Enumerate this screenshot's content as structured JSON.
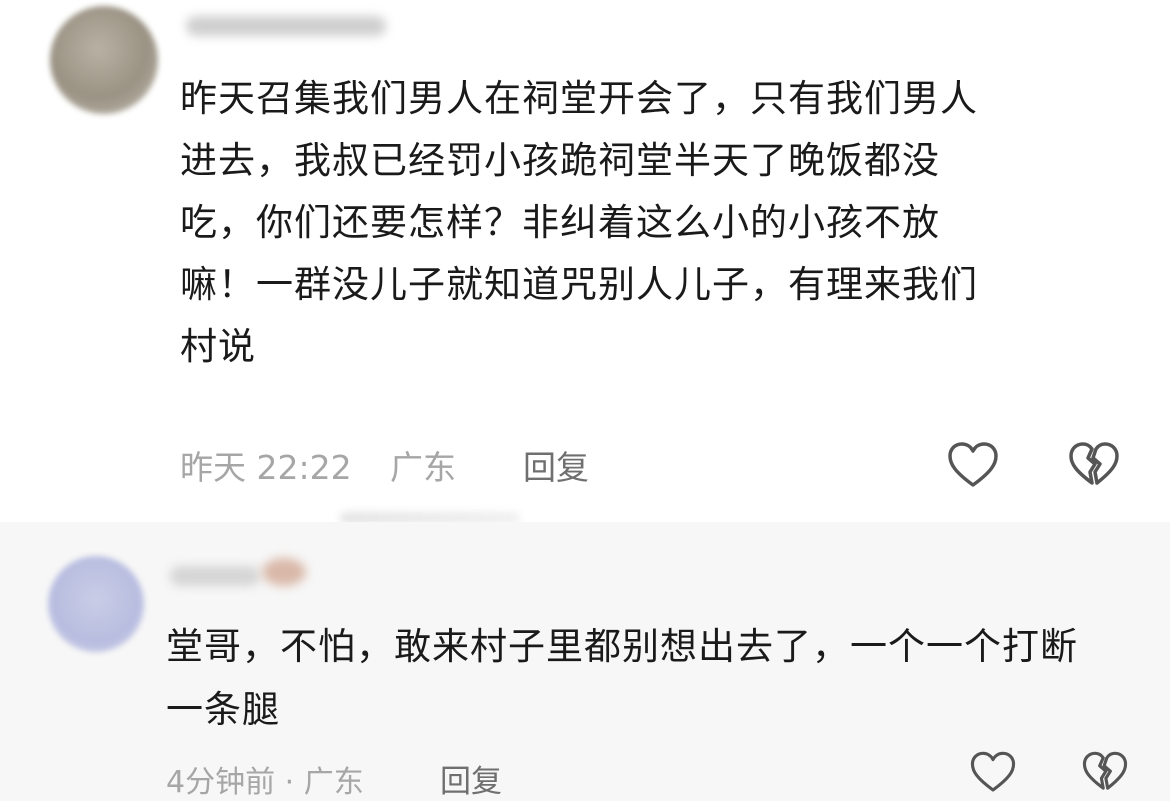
{
  "comments": [
    {
      "text": "昨天召集我们男人在祠堂开会了，只有我们男人\n进去，我叔已经罚小孩跪祠堂半天了晚饭都没\n吃，你们还要怎样？非纠着这么小的小孩不放\n嘛！一群没儿子就知道咒别人儿子，有理来我们\n村说",
      "time": "昨天 22:22",
      "location": "广东",
      "reply_label": "回复",
      "like_icon": "heart-outline-icon",
      "dislike_icon": "broken-heart-icon"
    },
    {
      "text": "堂哥，不怕，敢来村子里都别想出去了，一个一个打断\n一条腿",
      "time_location": "4分钟前 · 广东",
      "reply_label": "回复",
      "like_icon": "heart-outline-icon",
      "dislike_icon": "broken-heart-icon"
    }
  ],
  "colors": {
    "text": "#1a1a1a",
    "meta": "#a6a6a6",
    "reply": "#6f6f6f",
    "second_bg": "#f7f7f7"
  }
}
